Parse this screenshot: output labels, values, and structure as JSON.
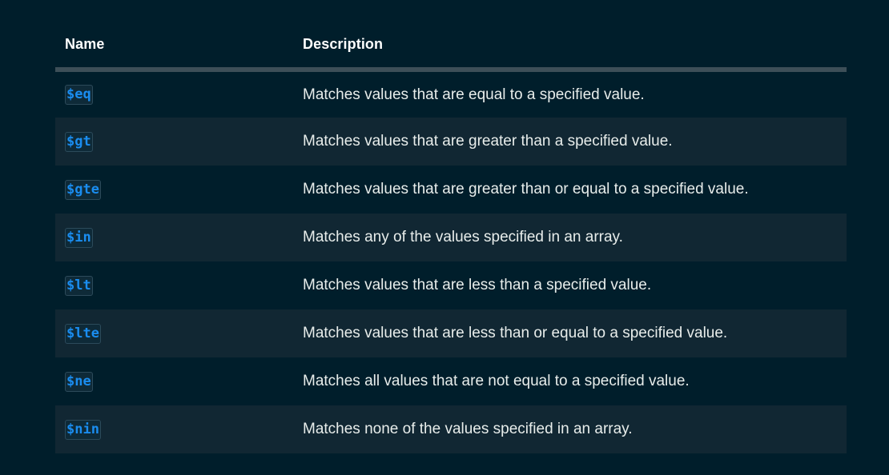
{
  "table": {
    "headers": {
      "name": "Name",
      "description": "Description"
    },
    "rows": [
      {
        "name": "$eq",
        "description": "Matches values that are equal to a specified value."
      },
      {
        "name": "$gt",
        "description": "Matches values that are greater than a specified value."
      },
      {
        "name": "$gte",
        "description": "Matches values that are greater than or equal to a specified value."
      },
      {
        "name": "$in",
        "description": "Matches any of the values specified in an array."
      },
      {
        "name": "$lt",
        "description": "Matches values that are less than a specified value."
      },
      {
        "name": "$lte",
        "description": "Matches values that are less than or equal to a specified value."
      },
      {
        "name": "$ne",
        "description": "Matches all values that are not equal to a specified value."
      },
      {
        "name": "$nin",
        "description": "Matches none of the values specified in an array."
      }
    ]
  },
  "colors": {
    "background": "#001e2b",
    "row_alt": "#112733",
    "header_rule": "#3d4f58",
    "code_text": "#1a8df0"
  }
}
